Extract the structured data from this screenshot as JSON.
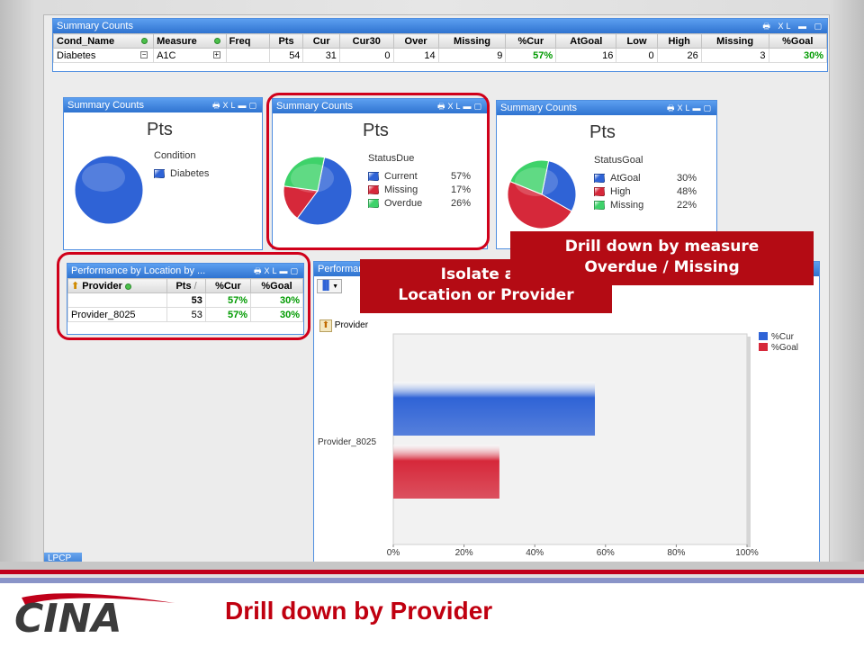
{
  "summary_top": {
    "title": "Summary Counts",
    "xl": "XL",
    "headers": [
      "Cond_Name",
      "Measure",
      "Freq",
      "Pts",
      "Cur",
      "Cur30",
      "Over",
      "Missing",
      "%Cur",
      "AtGoal",
      "Low",
      "High",
      "Missing",
      "%Goal"
    ],
    "row": [
      "Diabetes",
      "A1C",
      "",
      "54",
      "31",
      "0",
      "14",
      "9",
      "57%",
      "16",
      "0",
      "26",
      "3",
      "30%"
    ]
  },
  "pie_condition": {
    "title": "Summary Counts",
    "xl": "XL",
    "heading": "Pts",
    "legend_title": "Condition",
    "items": [
      {
        "label": "Diabetes",
        "value": "",
        "color": "#2f63d6"
      }
    ],
    "chart_data": {
      "type": "pie",
      "title": "Pts",
      "categories": [
        "Diabetes"
      ],
      "values": [
        100
      ]
    }
  },
  "pie_status_due": {
    "title": "Summary Counts",
    "xl": "XL",
    "heading": "Pts",
    "legend_title": "StatusDue",
    "items": [
      {
        "label": "Current",
        "value": "57%",
        "color": "#2f63d6"
      },
      {
        "label": "Missing",
        "value": "17%",
        "color": "#d6283a"
      },
      {
        "label": "Overdue",
        "value": "26%",
        "color": "#3ed26a"
      }
    ],
    "chart_data": {
      "type": "pie",
      "title": "Pts",
      "categories": [
        "Current",
        "Missing",
        "Overdue"
      ],
      "values": [
        57,
        17,
        26
      ]
    }
  },
  "pie_status_goal": {
    "title": "Summary Counts",
    "xl": "XL",
    "heading": "Pts",
    "legend_title": "StatusGoal",
    "items": [
      {
        "label": "AtGoal",
        "value": "30%",
        "color": "#2f63d6"
      },
      {
        "label": "High",
        "value": "48%",
        "color": "#d6283a"
      },
      {
        "label": "Missing",
        "value": "22%",
        "color": "#3ed26a"
      }
    ],
    "chart_data": {
      "type": "pie",
      "title": "Pts",
      "categories": [
        "AtGoal",
        "High",
        "Missing"
      ],
      "values": [
        30,
        48,
        22
      ]
    }
  },
  "perf_table": {
    "title": "Performance by Location by ...",
    "xl": "XL",
    "headers": [
      "Provider",
      "Pts",
      "%Cur",
      "%Goal"
    ],
    "sort_mark": "/",
    "total_row": [
      "",
      "53",
      "57%",
      "30%"
    ],
    "rows": [
      [
        "Provider_8025",
        "53",
        "57%",
        "30%"
      ]
    ]
  },
  "perf_chart": {
    "title": "Performan",
    "drill_label": "Provider",
    "chart_data": {
      "type": "bar",
      "orientation": "horizontal",
      "categories": [
        "Provider_8025"
      ],
      "series": [
        {
          "name": "%Cur",
          "values": [
            57
          ],
          "color": "#2f63d6"
        },
        {
          "name": "%Goal",
          "values": [
            30
          ],
          "color": "#d6283a"
        }
      ],
      "xlim": [
        0,
        100
      ],
      "ticks": [
        "0%",
        "20%",
        "40%",
        "60%",
        "80%",
        "100%"
      ]
    }
  },
  "tab_label": "LPCP",
  "callouts": {
    "isolate_line1": "Isolate a S",
    "isolate_line2": "Location or Provider",
    "drill_measure_line1": "Drill down by measure",
    "drill_measure_line2": "Overdue / Missing"
  },
  "footer": {
    "title": "Drill down by Provider",
    "logo": "CINA"
  }
}
